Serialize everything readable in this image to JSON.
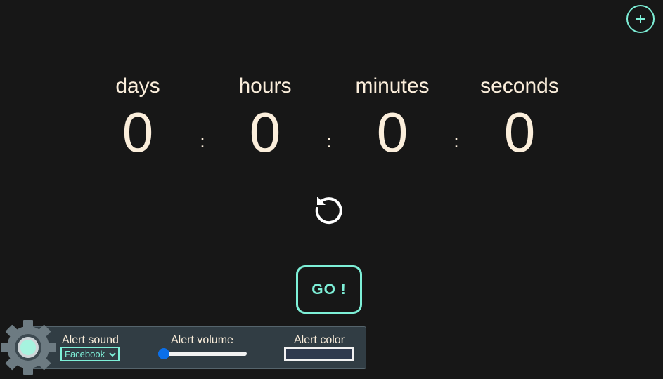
{
  "header": {
    "add_icon": "plus-icon"
  },
  "countdown": {
    "units": [
      {
        "label": "days",
        "value": "0"
      },
      {
        "label": "hours",
        "value": "0"
      },
      {
        "label": "minutes",
        "value": "0"
      },
      {
        "label": "seconds",
        "value": "0"
      }
    ],
    "separator": ":"
  },
  "controls": {
    "reset_icon": "reset-icon",
    "go_label": "GO !"
  },
  "settings": {
    "gear_icon": "gear-icon",
    "alert_sound_label": "Alert sound",
    "alert_sound_value": "Facebook",
    "alert_volume_label": "Alert volume",
    "alert_volume_value": 0.0,
    "alert_color_label": "Alert color",
    "alert_color_value": "#2f3a4e"
  },
  "colors": {
    "background": "#171717",
    "accent": "#7ef0d8",
    "text": "#fbeedb",
    "panel": "#313d44",
    "slider": "#0b6fe8"
  }
}
